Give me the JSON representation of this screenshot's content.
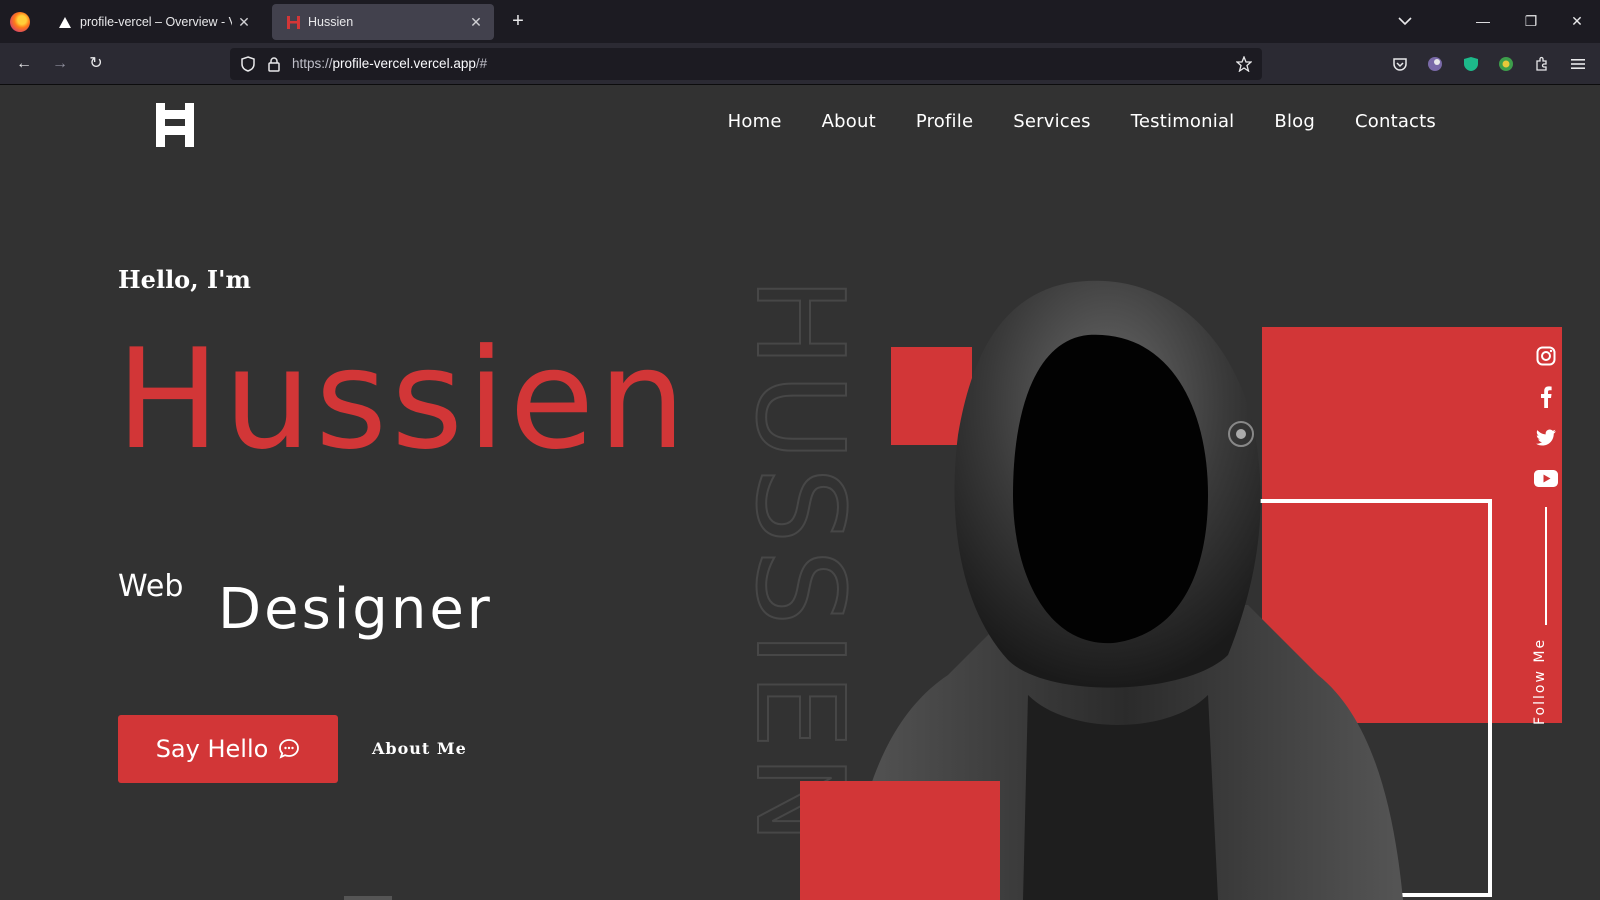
{
  "browser": {
    "tabs": [
      {
        "label": "profile-vercel – Overview - Vercel",
        "active": false
      },
      {
        "label": "Hussien",
        "active": true
      }
    ],
    "url_scheme": "https://",
    "url_host": "profile-vercel.vercel.app",
    "url_path": "/#"
  },
  "site": {
    "logo_text": "H",
    "nav": [
      "Home",
      "About",
      "Profile",
      "Services",
      "Testimonial",
      "Blog",
      "Contacts"
    ],
    "greeting": "Hello, I'm",
    "name": "Hussien",
    "role_prefix": "Web",
    "role_word": "Designer",
    "say_hello": "Say Hello",
    "about_me": "About Me",
    "background_text": "HUSSIEN",
    "follow_label": "Follow Me",
    "social": [
      "instagram-icon",
      "facebook-icon",
      "twitter-icon",
      "youtube-icon"
    ]
  },
  "colors": {
    "accent": "#d23637",
    "background": "#323232"
  }
}
